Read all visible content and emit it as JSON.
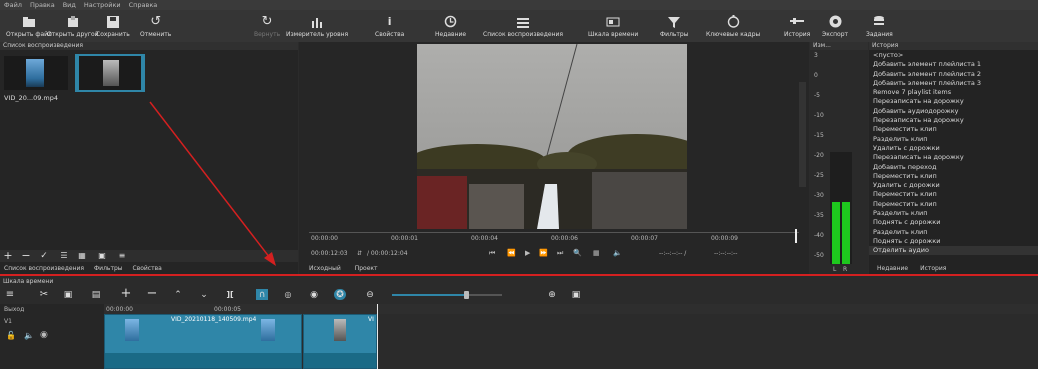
{
  "menu": [
    "Файл",
    "Правка",
    "Вид",
    "Настройки",
    "Справка"
  ],
  "toolbar": [
    {
      "label": "Открыть файл",
      "icon": "folder-icon"
    },
    {
      "label": "Открыть другой",
      "icon": "open-other-icon"
    },
    {
      "label": "Сохранить",
      "icon": "save-icon"
    },
    {
      "label": "Отменить",
      "icon": "undo-icon"
    },
    {
      "label": "Вернуть",
      "icon": "redo-icon"
    },
    {
      "label": "Измеритель уровня",
      "icon": "meter-icon"
    },
    {
      "label": "Свойства",
      "icon": "info-icon"
    },
    {
      "label": "Недавние",
      "icon": "clock-icon"
    },
    {
      "label": "Список воспроизведения",
      "icon": "list-icon"
    },
    {
      "label": "Шкала времени",
      "icon": "timeline-icon"
    },
    {
      "label": "Фильтры",
      "icon": "filter-icon"
    },
    {
      "label": "Ключевые кадры",
      "icon": "stopwatch-icon"
    },
    {
      "label": "История",
      "icon": "history-icon"
    },
    {
      "label": "Экспорт",
      "icon": "export-icon"
    },
    {
      "label": "Задания",
      "icon": "jobs-icon"
    }
  ],
  "playlist": {
    "title": "Список воспроизведения",
    "items": [
      {
        "label": "VID_20...09.mp4"
      },
      {
        "label": ""
      }
    ],
    "tabs": [
      "Список воспроизведения",
      "Фильтры",
      "Свойства"
    ]
  },
  "player": {
    "timecodes": [
      "00:00:00",
      "00:00:01",
      "00:00:04",
      "00:00:06",
      "00:00:07",
      "00:00:09"
    ],
    "position": "00:00:12:03",
    "duration": "/ 00:00:12:04",
    "in_point": "--:--:--:-- /",
    "out_point": "--:--:--:--",
    "tabs": [
      "Исходный",
      "Проект"
    ]
  },
  "meter": {
    "title": "Изм...",
    "scale": [
      "3",
      "0",
      "-5",
      "-10",
      "-15",
      "-20",
      "-25",
      "-30",
      "-35",
      "-40",
      "-50"
    ],
    "channels": [
      "L",
      "R"
    ],
    "level_left": 0.55,
    "level_right": 0.55
  },
  "history": {
    "title": "История",
    "items": [
      "<пусто>",
      "Добавить элемент плейлиста 1",
      "Добавить элемент плейлиста 2",
      "Добавить элемент плейлиста 3",
      "Remove 7 playlist items",
      "Перезаписать на дорожку",
      "Добавить аудиодорожку",
      "Перезаписать на дорожку",
      "Переместить клип",
      "Разделить клип",
      "Удалить с дорожки",
      "Перезаписать на дорожку",
      "Добавить переход",
      "Переместить клип",
      "Удалить с дорожки",
      "Переместить клип",
      "Переместить клип",
      "Разделить клип",
      "Поднять с дорожки",
      "Разделить клип",
      "Поднять с дорожки",
      "Отделить аудио"
    ],
    "tabs": [
      "Недавние",
      "История"
    ]
  },
  "timeline": {
    "title": "Шкала времени",
    "output_label": "Выход",
    "track_label": "V1",
    "ruler": [
      "00:00:00",
      "00:00:05"
    ],
    "clip_name": "VID_20210118_140509.mp4",
    "clip2_name": "VI"
  },
  "colors": {
    "accent": "#2f86a8",
    "meter": "#1ec81e",
    "annotation": "#d42020"
  }
}
